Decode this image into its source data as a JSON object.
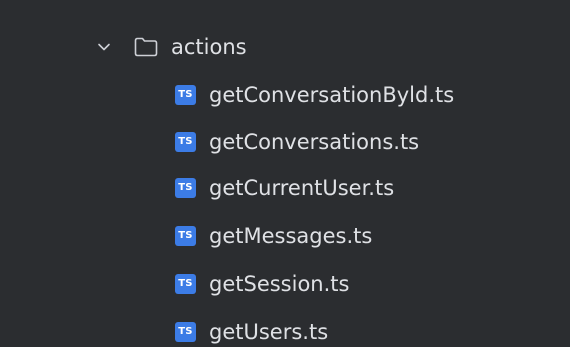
{
  "tree": {
    "folder": {
      "name": "actions",
      "expanded": true,
      "chevron_icon": "chevron-down-icon",
      "icon": "folder-icon"
    },
    "files": [
      {
        "name": "getConversationByld.ts",
        "icon": "typescript-file-icon",
        "badge": "TS"
      },
      {
        "name": "getConversations.ts",
        "icon": "typescript-file-icon",
        "badge": "TS"
      },
      {
        "name": "getCurrentUser.ts",
        "icon": "typescript-file-icon",
        "badge": "TS"
      },
      {
        "name": "getMessages.ts",
        "icon": "typescript-file-icon",
        "badge": "TS"
      },
      {
        "name": "getSession.ts",
        "icon": "typescript-file-icon",
        "badge": "TS"
      },
      {
        "name": "getUsers.ts",
        "icon": "typescript-file-icon",
        "badge": "TS"
      }
    ]
  },
  "colors": {
    "panel_background": "#2b2d30",
    "text": "#dfe1e5",
    "ts_badge": "#3c7ce6",
    "icon_stroke": "#ced0d6"
  }
}
